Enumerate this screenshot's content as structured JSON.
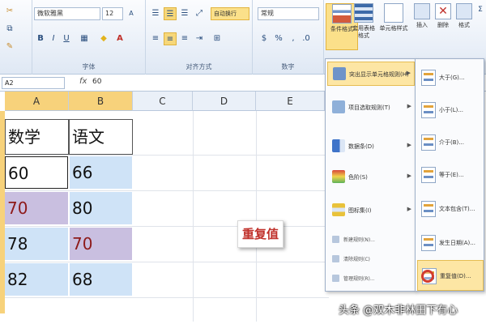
{
  "ribbon": {
    "font_name": "微软雅黑",
    "font_size": "12",
    "wrap_label": "自动换行",
    "number_format": "常规",
    "groups": {
      "font": "字体",
      "alignment": "对齐方式",
      "number": "数字"
    },
    "buttons": {
      "conditional_formatting": "条件格式",
      "format_as_table": "套用表格格式",
      "cell_styles": "单元格样式",
      "insert": "插入",
      "delete": "删除",
      "format": "格式"
    }
  },
  "formula_bar": {
    "name_box": "A2",
    "fx": "fx",
    "value": "60"
  },
  "grid": {
    "columns": [
      "A",
      "B",
      "C",
      "D",
      "E"
    ],
    "headers": [
      "数学",
      "语文"
    ],
    "rows": [
      [
        "60",
        "66"
      ],
      [
        "70",
        "80"
      ],
      [
        "78",
        "70"
      ],
      [
        "82",
        "68"
      ]
    ]
  },
  "callout": "重复值",
  "cf_menu": {
    "items": [
      "突出显示单元格规则(H)",
      "项目选取规则(T)",
      "数据条(D)",
      "色阶(S)",
      "图标集(I)"
    ],
    "small_items": [
      "新建规则(N)...",
      "清除规则(C)",
      "管理规则(R)..."
    ]
  },
  "submenu": {
    "items": [
      "大于(G)...",
      "小于(L)...",
      "介于(B)...",
      "等于(E)...",
      "文本包含(T)...",
      "发生日期(A)...",
      "重复值(D)..."
    ]
  },
  "watermark": "头条 @双木非林田下有心",
  "colors": {
    "selection_header": "#f7d27b",
    "fill_blue": "#cfe3f7",
    "fill_duplicate": "#c9bfe0",
    "duplicate_text": "#8e1a1a",
    "callout_text": "#c0302a"
  }
}
